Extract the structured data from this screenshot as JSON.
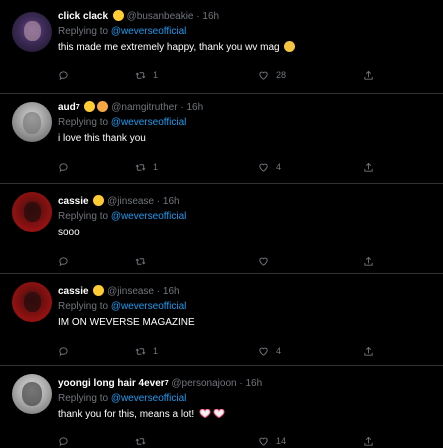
{
  "colors": {
    "background": "#000000",
    "accent": "#1d9bf0",
    "muted": "#71767b",
    "divider": "#2f3336"
  },
  "tweets": [
    {
      "name": "click clack",
      "name_sup": "",
      "emojis": [
        "chick-emoji"
      ],
      "handle": "@busanbeakie",
      "time": "16h",
      "reply_prefix": "Replying to",
      "reply_to": "@weverseofficial",
      "text": "this made me extremely happy, thank you wv mag",
      "text_emoji": "smiling-face-emoji",
      "counts": {
        "reply": "",
        "retweet": "1",
        "like": "28"
      }
    },
    {
      "name": "aud",
      "name_sup": "7",
      "emojis": [
        "chick-emoji",
        "dizzy-emoji"
      ],
      "handle": "@namgitruther",
      "time": "16h",
      "reply_prefix": "Replying to",
      "reply_to": "@weverseofficial",
      "text": "i love this thank you",
      "counts": {
        "reply": "",
        "retweet": "1",
        "like": "4"
      }
    },
    {
      "name": "cassie",
      "name_sup": "",
      "emojis": [
        "chick-emoji"
      ],
      "handle": "@jinsease",
      "time": "16h",
      "reply_prefix": "Replying to",
      "reply_to": "@weverseofficial",
      "text": "sooo",
      "counts": {
        "reply": "",
        "retweet": "",
        "like": ""
      }
    },
    {
      "name": "cassie",
      "name_sup": "",
      "emojis": [
        "chick-emoji"
      ],
      "handle": "@jinsease",
      "time": "16h",
      "reply_prefix": "Replying to",
      "reply_to": "@weverseofficial",
      "text": "IM ON WEVERSE MAGAZINE",
      "counts": {
        "reply": "",
        "retweet": "1",
        "like": "4"
      }
    },
    {
      "name": "yoongi long hair 4ever",
      "name_sup": "7",
      "emojis": [],
      "handle": "@personajoon",
      "time": "16h",
      "reply_prefix": "Replying to",
      "reply_to": "@weverseofficial",
      "text": "thank you for this, means a lot!",
      "text_emoji": "heart-hands-emoji",
      "counts": {
        "reply": "",
        "retweet": "",
        "like": "14"
      }
    }
  ]
}
